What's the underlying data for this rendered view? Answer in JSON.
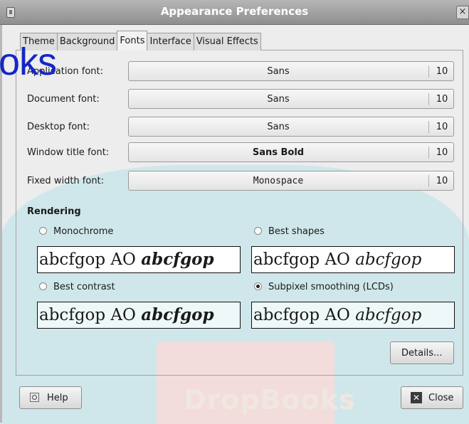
{
  "window": {
    "title": "Appearance Preferences",
    "close_glyph": "×"
  },
  "watermark": {
    "overlay_text": "oks",
    "bottom_text": "DropBooks"
  },
  "tabs": [
    {
      "label": "Theme",
      "active": false
    },
    {
      "label": "Background",
      "active": false
    },
    {
      "label": "Fonts",
      "active": true
    },
    {
      "label": "Interface",
      "active": false
    },
    {
      "label": "Visual Effects",
      "active": false
    }
  ],
  "fonts": {
    "application": {
      "label": "Application font:",
      "font": "Sans",
      "size": "10"
    },
    "document": {
      "label": "Document font:",
      "font": "Sans",
      "size": "10"
    },
    "desktop": {
      "label": "Desktop font:",
      "font": "Sans",
      "size": "10"
    },
    "window_title": {
      "label": "Window title font:",
      "font": "Sans Bold",
      "size": "10"
    },
    "fixed_width": {
      "label": "Fixed width font:",
      "font": "Monospace",
      "size": "10"
    }
  },
  "rendering": {
    "title": "Rendering",
    "options": [
      {
        "label": "Monochrome",
        "selected": false,
        "sample_plain": "abcfgop AO ",
        "sample_italic": "abcfgop"
      },
      {
        "label": "Best shapes",
        "selected": false,
        "sample_plain": "abcfgop AO ",
        "sample_italic": "abcfgop"
      },
      {
        "label": "Best contrast",
        "selected": false,
        "sample_plain": "abcfgop AO ",
        "sample_italic": "abcfgop"
      },
      {
        "label": "Subpixel smoothing (LCDs)",
        "selected": true,
        "sample_plain": "abcfgop AO ",
        "sample_italic": "abcfgop"
      }
    ]
  },
  "buttons": {
    "details": "Details...",
    "help": "Help",
    "close": "Close"
  }
}
